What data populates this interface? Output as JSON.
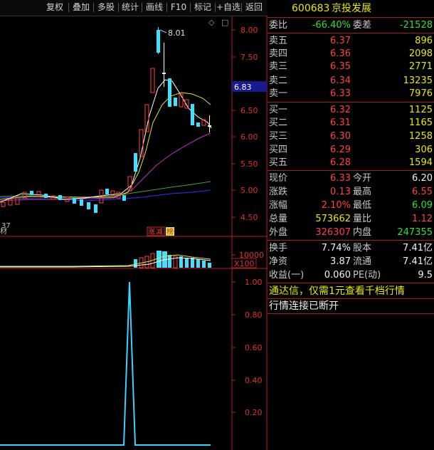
{
  "toolbar": {
    "buttons": [
      "复权",
      "叠加",
      "多股",
      "统计",
      "画线",
      "F10",
      "标记",
      "+自选",
      "返回"
    ]
  },
  "chart": {
    "price_ticks": [
      "8.00",
      "7.50",
      "7.00",
      "6.50",
      "6.00",
      "5.50",
      "5.00",
      "4.50"
    ],
    "current_price_tag": "6.83",
    "high_label": "8.01",
    "low_label": "37",
    "left_edge_label": "材",
    "vol_tick": "10000",
    "vol_unit": "X100",
    "indicator_ticks": [
      "1.00",
      "0.80",
      "0.60",
      "0.40",
      "0.20"
    ],
    "tag_limit": "涨",
    "tag_reduce": "减",
    "tag_list": "榜",
    "diamond_marker": "◇",
    "box_marker": "□"
  },
  "quote": {
    "code": "600683",
    "name": "京投发展",
    "wb_label": "委比",
    "wb_value": "-66.40%",
    "wc_label": "委差",
    "wc_value": "-21528",
    "asks": [
      {
        "label": "卖五",
        "price": "6.37",
        "vol": "896"
      },
      {
        "label": "卖四",
        "price": "6.36",
        "vol": "2098"
      },
      {
        "label": "卖三",
        "price": "6.35",
        "vol": "2771"
      },
      {
        "label": "卖二",
        "price": "6.34",
        "vol": "13235"
      },
      {
        "label": "卖一",
        "price": "6.33",
        "vol": "7976"
      }
    ],
    "bids": [
      {
        "label": "买一",
        "price": "6.32",
        "vol": "1125"
      },
      {
        "label": "买二",
        "price": "6.31",
        "vol": "1165"
      },
      {
        "label": "买三",
        "price": "6.30",
        "vol": "1258"
      },
      {
        "label": "买四",
        "price": "6.29",
        "vol": "306"
      },
      {
        "label": "买五",
        "price": "6.28",
        "vol": "1594"
      }
    ],
    "stats": [
      {
        "l1": "现价",
        "v1": "6.33",
        "c1": "red",
        "l2": "今开",
        "v2": "6.20",
        "c2": "white"
      },
      {
        "l1": "涨跌",
        "v1": "0.13",
        "c1": "red",
        "l2": "最高",
        "v2": "6.55",
        "c2": "red"
      },
      {
        "l1": "涨幅",
        "v1": "2.10%",
        "c1": "red",
        "l2": "最低",
        "v2": "6.09",
        "c2": "green"
      },
      {
        "l1": "总量",
        "v1": "573662",
        "c1": "yellow",
        "l2": "量比",
        "v2": "1.12",
        "c2": "red"
      },
      {
        "l1": "外盘",
        "v1": "326307",
        "c1": "red",
        "l2": "内盘",
        "v2": "247355",
        "c2": "green"
      }
    ],
    "fin": [
      {
        "l1": "换手",
        "v1": "7.74%",
        "l2": "股本",
        "v2": "7.41亿"
      },
      {
        "l1": "净资",
        "v1": "3.87",
        "l2": "流通",
        "v2": "7.41亿"
      },
      {
        "l1": "收益(一)",
        "v1": "0.060",
        "l2": "PE(动)",
        "v2": "9.5"
      }
    ],
    "notice": "通达信，仅需1元查看千档行情",
    "status": "行情连接已断开"
  }
}
